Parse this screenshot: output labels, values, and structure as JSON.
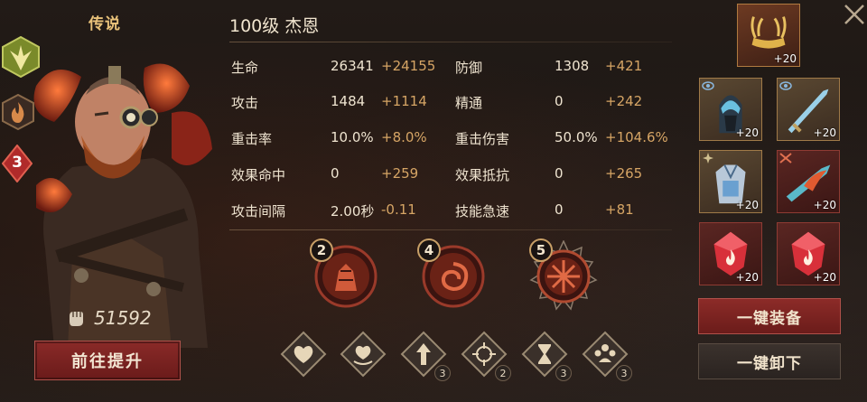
{
  "hero": {
    "rarity": "传说",
    "title": "100级 杰恩",
    "star_rank": "3",
    "power": "51592",
    "upgrade_button": "前往提升"
  },
  "stats": [
    {
      "label": "生命",
      "value": "26341",
      "bonus": "+24155"
    },
    {
      "label": "防御",
      "value": "1308",
      "bonus": "+421"
    },
    {
      "label": "攻击",
      "value": "1484",
      "bonus": "+1114"
    },
    {
      "label": "精通",
      "value": "0",
      "bonus": "+242"
    },
    {
      "label": "重击率",
      "value": "10.0%",
      "bonus": "+8.0%"
    },
    {
      "label": "重击伤害",
      "value": "50.0%",
      "bonus": "+104.6%"
    },
    {
      "label": "效果命中",
      "value": "0",
      "bonus": "+259"
    },
    {
      "label": "效果抵抗",
      "value": "0",
      "bonus": "+265"
    },
    {
      "label": "攻击间隔",
      "value": "2.00秒",
      "bonus": "-0.11"
    },
    {
      "label": "技能急速",
      "value": "0",
      "bonus": "+81"
    }
  ],
  "set_bonuses": [
    {
      "count": "2",
      "icon": "set-warrior-icon"
    },
    {
      "count": "4",
      "icon": "set-spiral-icon"
    },
    {
      "count": "5",
      "icon": "set-wheel-icon"
    }
  ],
  "skills": [
    {
      "icon": "heart-icon",
      "level": ""
    },
    {
      "icon": "heart-shield-icon",
      "level": ""
    },
    {
      "icon": "upgrade-arrow-icon",
      "level": "3"
    },
    {
      "icon": "crosshair-icon",
      "level": "2"
    },
    {
      "icon": "hourglass-icon",
      "level": "3"
    },
    {
      "icon": "crown-icon",
      "level": "3"
    }
  ],
  "equipment": [
    {
      "slot": "helmet",
      "enhance": "+20"
    },
    {
      "slot": "armor",
      "enhance": "+20"
    },
    {
      "slot": "weapon",
      "enhance": "+20"
    },
    {
      "slot": "chest",
      "enhance": "+20"
    },
    {
      "slot": "offhand",
      "enhance": "+20"
    },
    {
      "slot": "gem-1",
      "enhance": "+20"
    },
    {
      "slot": "gem-2",
      "enhance": "+20"
    }
  ],
  "buttons": {
    "equip_all": "一键装备",
    "unequip_all": "一键卸下"
  },
  "colors": {
    "accent_gold": "#d6a565",
    "button_red": "#8c2b28",
    "rarity_gold": "#e9c27a"
  }
}
